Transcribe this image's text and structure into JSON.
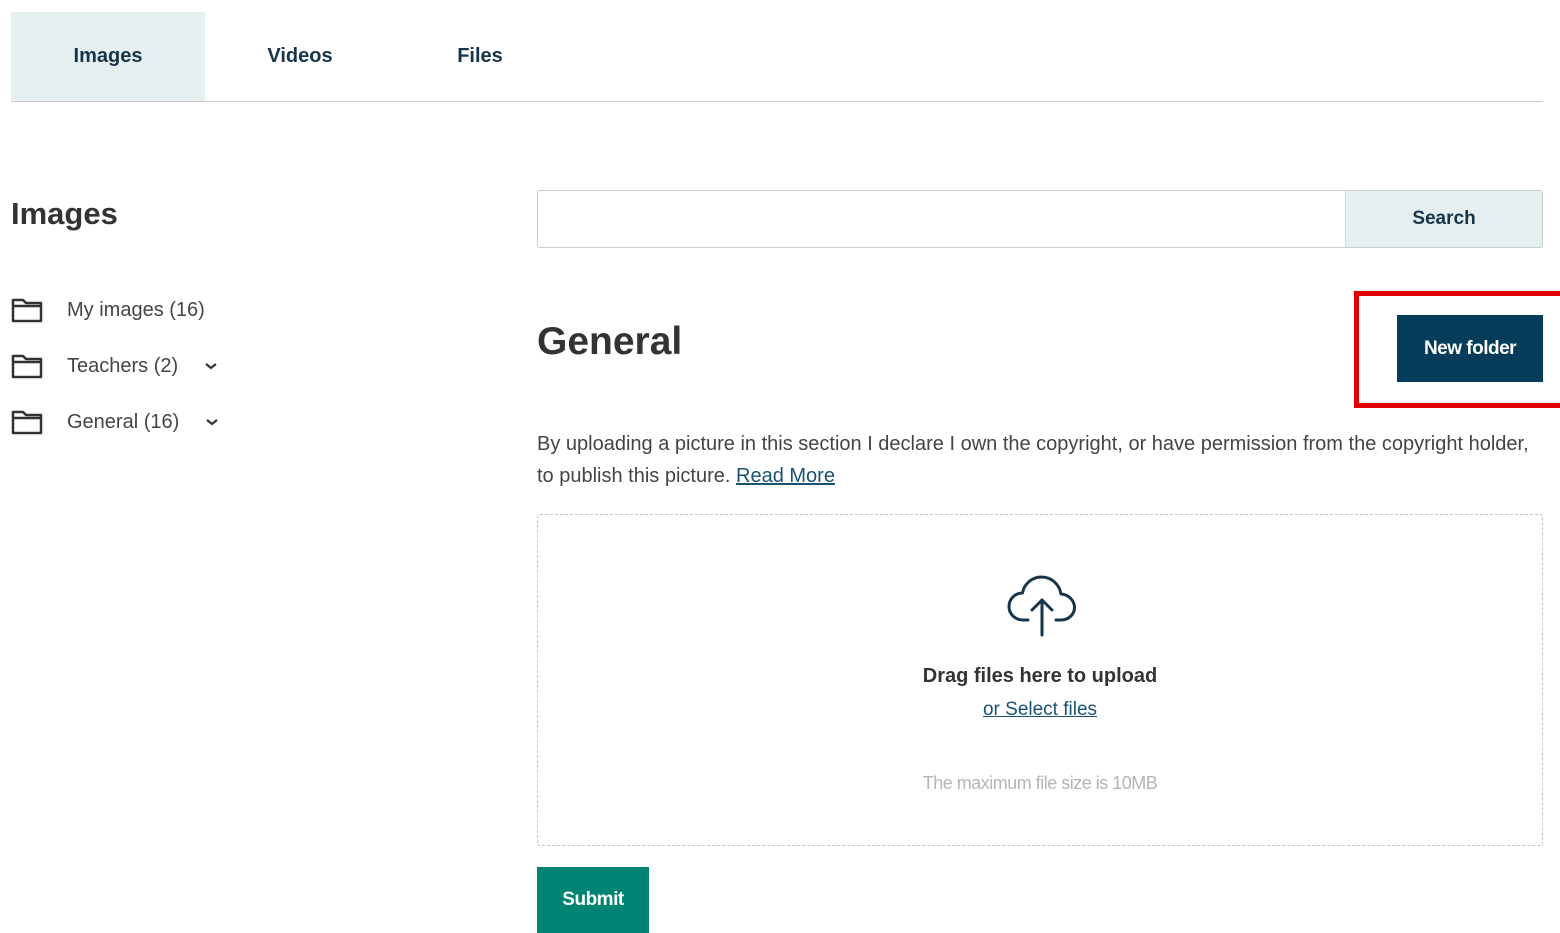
{
  "tabs": [
    {
      "label": "Images",
      "active": true
    },
    {
      "label": "Videos",
      "active": false
    },
    {
      "label": "Files",
      "active": false
    }
  ],
  "sidebar": {
    "title": "Images",
    "folders": [
      {
        "label": "My images (16)",
        "icon": "folder-icon",
        "expandable": false
      },
      {
        "label": "Teachers (2)",
        "icon": "folder-icon",
        "expandable": true
      },
      {
        "label": "General (16)",
        "icon": "folder-icon",
        "expandable": true
      }
    ]
  },
  "search": {
    "value": "",
    "placeholder": "",
    "button_label": "Search"
  },
  "main": {
    "title": "General",
    "new_folder_label": "New folder",
    "notice_text": "By uploading a picture in this section I declare I own the copyright, or have permission from the copyright holder, to publish this picture.",
    "read_more_label": "Read More",
    "upload": {
      "icon": "cloud-upload-icon",
      "drag_text": "Drag files here to upload",
      "select_label": "or Select files",
      "max_size_text": "The maximum file size is 10MB"
    },
    "submit_label": "Submit"
  },
  "colors": {
    "tab_active_bg": "#e6eff0",
    "primary_dark": "#053c5a",
    "submit_green": "#008574",
    "highlight_red": "#e00000",
    "link": "#1a5276"
  }
}
